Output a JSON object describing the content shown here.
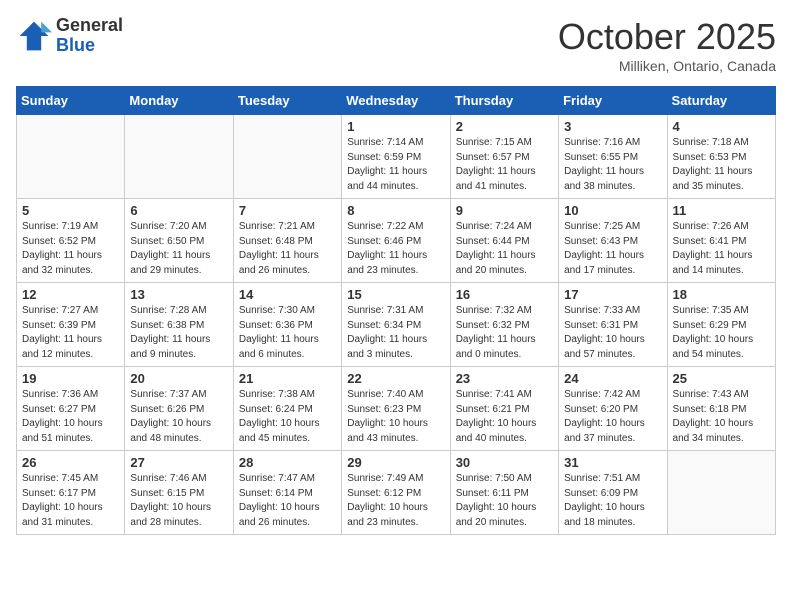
{
  "header": {
    "logo_general": "General",
    "logo_blue": "Blue",
    "month_title": "October 2025",
    "subtitle": "Milliken, Ontario, Canada"
  },
  "weekdays": [
    "Sunday",
    "Monday",
    "Tuesday",
    "Wednesday",
    "Thursday",
    "Friday",
    "Saturday"
  ],
  "weeks": [
    [
      {
        "day": "",
        "info": ""
      },
      {
        "day": "",
        "info": ""
      },
      {
        "day": "",
        "info": ""
      },
      {
        "day": "1",
        "info": "Sunrise: 7:14 AM\nSunset: 6:59 PM\nDaylight: 11 hours\nand 44 minutes."
      },
      {
        "day": "2",
        "info": "Sunrise: 7:15 AM\nSunset: 6:57 PM\nDaylight: 11 hours\nand 41 minutes."
      },
      {
        "day": "3",
        "info": "Sunrise: 7:16 AM\nSunset: 6:55 PM\nDaylight: 11 hours\nand 38 minutes."
      },
      {
        "day": "4",
        "info": "Sunrise: 7:18 AM\nSunset: 6:53 PM\nDaylight: 11 hours\nand 35 minutes."
      }
    ],
    [
      {
        "day": "5",
        "info": "Sunrise: 7:19 AM\nSunset: 6:52 PM\nDaylight: 11 hours\nand 32 minutes."
      },
      {
        "day": "6",
        "info": "Sunrise: 7:20 AM\nSunset: 6:50 PM\nDaylight: 11 hours\nand 29 minutes."
      },
      {
        "day": "7",
        "info": "Sunrise: 7:21 AM\nSunset: 6:48 PM\nDaylight: 11 hours\nand 26 minutes."
      },
      {
        "day": "8",
        "info": "Sunrise: 7:22 AM\nSunset: 6:46 PM\nDaylight: 11 hours\nand 23 minutes."
      },
      {
        "day": "9",
        "info": "Sunrise: 7:24 AM\nSunset: 6:44 PM\nDaylight: 11 hours\nand 20 minutes."
      },
      {
        "day": "10",
        "info": "Sunrise: 7:25 AM\nSunset: 6:43 PM\nDaylight: 11 hours\nand 17 minutes."
      },
      {
        "day": "11",
        "info": "Sunrise: 7:26 AM\nSunset: 6:41 PM\nDaylight: 11 hours\nand 14 minutes."
      }
    ],
    [
      {
        "day": "12",
        "info": "Sunrise: 7:27 AM\nSunset: 6:39 PM\nDaylight: 11 hours\nand 12 minutes."
      },
      {
        "day": "13",
        "info": "Sunrise: 7:28 AM\nSunset: 6:38 PM\nDaylight: 11 hours\nand 9 minutes."
      },
      {
        "day": "14",
        "info": "Sunrise: 7:30 AM\nSunset: 6:36 PM\nDaylight: 11 hours\nand 6 minutes."
      },
      {
        "day": "15",
        "info": "Sunrise: 7:31 AM\nSunset: 6:34 PM\nDaylight: 11 hours\nand 3 minutes."
      },
      {
        "day": "16",
        "info": "Sunrise: 7:32 AM\nSunset: 6:32 PM\nDaylight: 11 hours\nand 0 minutes."
      },
      {
        "day": "17",
        "info": "Sunrise: 7:33 AM\nSunset: 6:31 PM\nDaylight: 10 hours\nand 57 minutes."
      },
      {
        "day": "18",
        "info": "Sunrise: 7:35 AM\nSunset: 6:29 PM\nDaylight: 10 hours\nand 54 minutes."
      }
    ],
    [
      {
        "day": "19",
        "info": "Sunrise: 7:36 AM\nSunset: 6:27 PM\nDaylight: 10 hours\nand 51 minutes."
      },
      {
        "day": "20",
        "info": "Sunrise: 7:37 AM\nSunset: 6:26 PM\nDaylight: 10 hours\nand 48 minutes."
      },
      {
        "day": "21",
        "info": "Sunrise: 7:38 AM\nSunset: 6:24 PM\nDaylight: 10 hours\nand 45 minutes."
      },
      {
        "day": "22",
        "info": "Sunrise: 7:40 AM\nSunset: 6:23 PM\nDaylight: 10 hours\nand 43 minutes."
      },
      {
        "day": "23",
        "info": "Sunrise: 7:41 AM\nSunset: 6:21 PM\nDaylight: 10 hours\nand 40 minutes."
      },
      {
        "day": "24",
        "info": "Sunrise: 7:42 AM\nSunset: 6:20 PM\nDaylight: 10 hours\nand 37 minutes."
      },
      {
        "day": "25",
        "info": "Sunrise: 7:43 AM\nSunset: 6:18 PM\nDaylight: 10 hours\nand 34 minutes."
      }
    ],
    [
      {
        "day": "26",
        "info": "Sunrise: 7:45 AM\nSunset: 6:17 PM\nDaylight: 10 hours\nand 31 minutes."
      },
      {
        "day": "27",
        "info": "Sunrise: 7:46 AM\nSunset: 6:15 PM\nDaylight: 10 hours\nand 28 minutes."
      },
      {
        "day": "28",
        "info": "Sunrise: 7:47 AM\nSunset: 6:14 PM\nDaylight: 10 hours\nand 26 minutes."
      },
      {
        "day": "29",
        "info": "Sunrise: 7:49 AM\nSunset: 6:12 PM\nDaylight: 10 hours\nand 23 minutes."
      },
      {
        "day": "30",
        "info": "Sunrise: 7:50 AM\nSunset: 6:11 PM\nDaylight: 10 hours\nand 20 minutes."
      },
      {
        "day": "31",
        "info": "Sunrise: 7:51 AM\nSunset: 6:09 PM\nDaylight: 10 hours\nand 18 minutes."
      },
      {
        "day": "",
        "info": ""
      }
    ]
  ]
}
